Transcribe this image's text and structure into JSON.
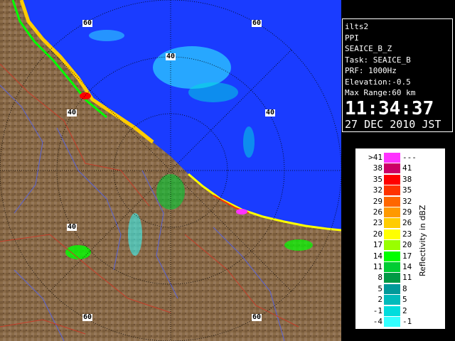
{
  "radar": {
    "range_rings": [
      {
        "label": "60"
      },
      {
        "label": "60"
      },
      {
        "label": "40"
      },
      {
        "label": "40"
      },
      {
        "label": "40"
      },
      {
        "label": "40"
      },
      {
        "label": "60"
      },
      {
        "label": "60"
      }
    ],
    "colors": {
      "sea": "#1a3cff",
      "land": "#8a6b48",
      "land_dark": "#6e5236",
      "ring": "#000000",
      "river": "#5a64d8",
      "border": "#c83c28"
    }
  },
  "info": {
    "station": "ilts2",
    "scan_type": "PPI",
    "product": "SEAICE_B_Z",
    "task": "Task: SEAICE_B",
    "prf": "PRF: 1000Hz",
    "elevation": "Elevation:-0.5",
    "max_range": "Max Range:60 km",
    "time": "11:34:37",
    "date": "27 DEC 2010 JST"
  },
  "legend": {
    "unit": "Reflectivity in dBZ",
    "rows": [
      {
        "lo": ">41",
        "hi": "---",
        "color": "#ff33ff"
      },
      {
        "lo": "38",
        "hi": "41",
        "color": "#cc0066"
      },
      {
        "lo": "35",
        "hi": "38",
        "color": "#ff0000"
      },
      {
        "lo": "32",
        "hi": "35",
        "color": "#ff3300"
      },
      {
        "lo": "29",
        "hi": "32",
        "color": "#ff6600"
      },
      {
        "lo": "26",
        "hi": "29",
        "color": "#ff9900"
      },
      {
        "lo": "23",
        "hi": "26",
        "color": "#ffcc00"
      },
      {
        "lo": "20",
        "hi": "23",
        "color": "#ffff00"
      },
      {
        "lo": "17",
        "hi": "20",
        "color": "#99ff00"
      },
      {
        "lo": "14",
        "hi": "17",
        "color": "#00ff00"
      },
      {
        "lo": "11",
        "hi": "14",
        "color": "#00cc33"
      },
      {
        "lo": "8",
        "hi": "11",
        "color": "#009944"
      },
      {
        "lo": "5",
        "hi": "8",
        "color": "#009999"
      },
      {
        "lo": "2",
        "hi": "5",
        "color": "#00bbbb"
      },
      {
        "lo": "-1",
        "hi": "2",
        "color": "#00dddd"
      },
      {
        "lo": "-4",
        "hi": "-1",
        "color": "#33ffff"
      }
    ]
  }
}
